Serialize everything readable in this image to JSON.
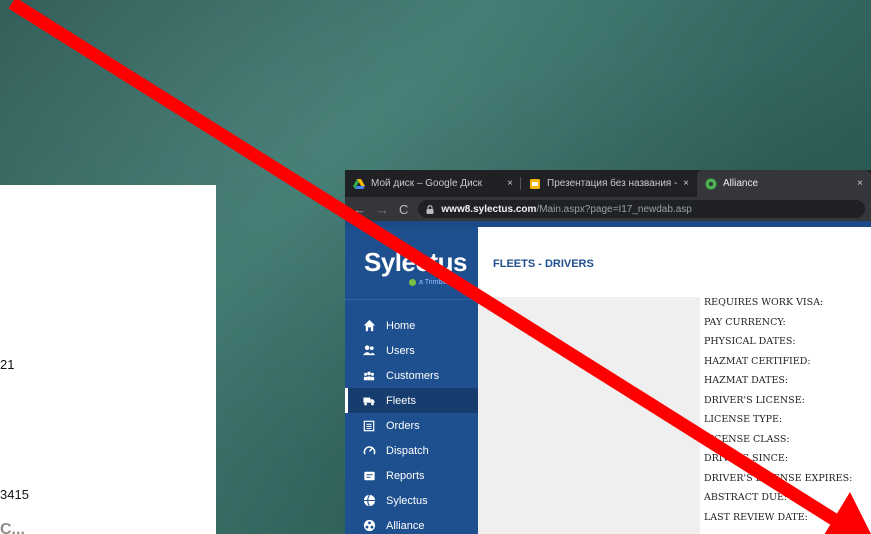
{
  "document": {
    "fragments": [
      "21",
      "3415",
      "C..."
    ]
  },
  "browser": {
    "tabs": [
      {
        "title": "Мой диск – Google Диск",
        "close": "×"
      },
      {
        "title": "Презентация без названия - Go",
        "close": "×"
      },
      {
        "title": "Alliance",
        "close": "×"
      }
    ],
    "url_host": "www8.sylectus.com",
    "url_path": "/Main.aspx?page=I17_newdab.asp"
  },
  "app": {
    "logo": "Sylectus",
    "logo_sub": "a Trimble",
    "page_title": "FLEETS - DRIVERS",
    "menu": [
      {
        "label": "Home",
        "icon": "home-icon"
      },
      {
        "label": "Users",
        "icon": "users-icon"
      },
      {
        "label": "Customers",
        "icon": "customers-icon"
      },
      {
        "label": "Fleets",
        "icon": "truck-icon",
        "active": true
      },
      {
        "label": "Orders",
        "icon": "orders-icon"
      },
      {
        "label": "Dispatch",
        "icon": "dispatch-icon"
      },
      {
        "label": "Reports",
        "icon": "reports-icon"
      },
      {
        "label": "Sylectus",
        "icon": "sylectus-icon"
      },
      {
        "label": "Alliance",
        "icon": "alliance-icon"
      }
    ],
    "fields": [
      "REQUIRES WORK VISA:",
      "PAY CURRENCY:",
      "PHYSICAL DATES:",
      "HAZMAT CERTIFIED:",
      "HAZMAT DATES:",
      "DRIVER'S LICENSE:",
      "LICENSE TYPE:",
      "LICENSE CLASS:",
      "DRIVING SINCE:",
      "DRIVER'S LICENSE EXPIRES:",
      "ABSTRACT DUE:",
      "LAST REVIEW DATE:"
    ]
  },
  "colors": {
    "arrow": "#ff0000",
    "sidebar": "#1e4f8f",
    "accent": "#1e4f8f"
  }
}
